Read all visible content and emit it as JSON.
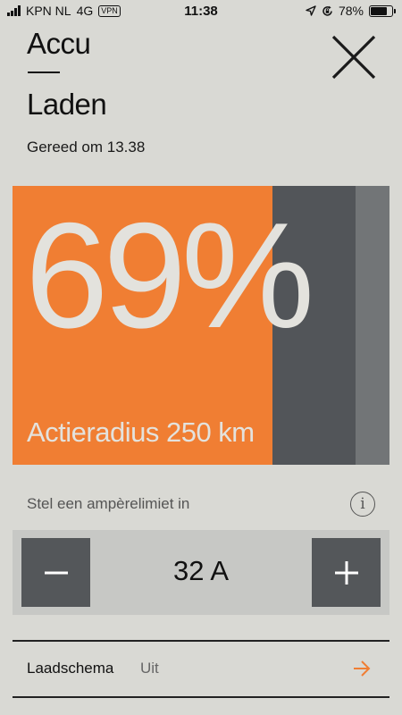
{
  "status_bar": {
    "carrier": "KPN NL",
    "network": "4G",
    "vpn": "VPN",
    "time": "11:38",
    "battery_percent": "78%",
    "battery_level": 0.78,
    "icons": [
      "signal-icon",
      "location-arrow-icon",
      "screen-rotation-lock-icon",
      "battery-icon"
    ]
  },
  "header": {
    "title_line1": "Accu",
    "title_line2": "Laden",
    "close_icon": "close-icon",
    "ready_text": "Gereed om 13.38"
  },
  "battery_card": {
    "percent_text": "69%",
    "charge_level": 0.69,
    "target_level": 0.91,
    "range_text": "Actieradius 250 km",
    "colors": {
      "charged": "#f07e33",
      "target": "#525559",
      "rest": "#727577"
    }
  },
  "ampere_limit": {
    "label": "Stel een ampèrelimiet in",
    "info_icon": "info-icon",
    "value": "32 A",
    "minus_icon": "minus-icon",
    "plus_icon": "plus-icon"
  },
  "schedule": {
    "label": "Laadschema",
    "value": "Uit",
    "arrow_icon": "arrow-right-icon",
    "accent": "#f07e33"
  }
}
